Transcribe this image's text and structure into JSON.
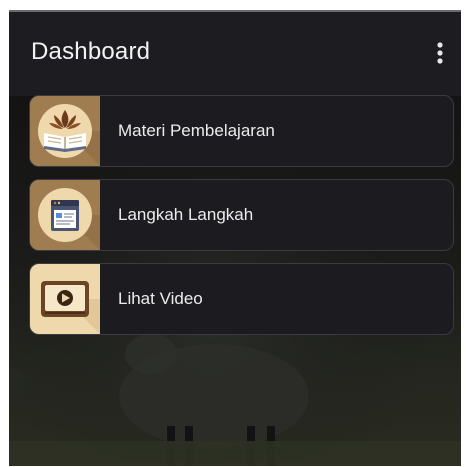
{
  "appbar": {
    "title": "Dashboard",
    "overflow_icon": "more-vert-icon"
  },
  "menu": {
    "items": [
      {
        "label": "Materi Pembelajaran",
        "icon": "book-plant-icon"
      },
      {
        "label": "Langkah Langkah",
        "icon": "document-list-icon"
      },
      {
        "label": "Lihat Video",
        "icon": "video-play-icon"
      }
    ]
  },
  "colors": {
    "appbar_bg": "#1d1c20",
    "card_bg": "#1c1b20",
    "icon_tile": "#a07d51",
    "icon_circle": "#f0d8ad"
  }
}
